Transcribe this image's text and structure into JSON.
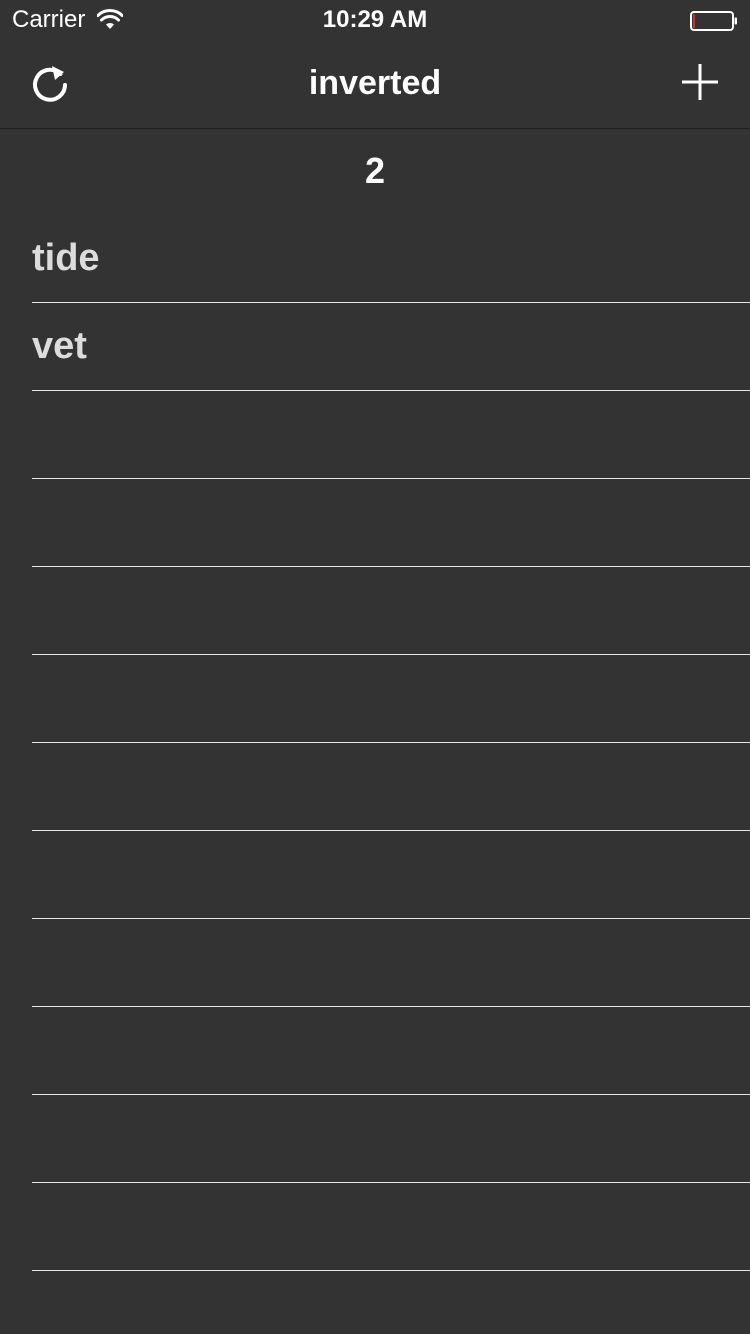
{
  "status_bar": {
    "carrier": "Carrier",
    "time": "10:29 AM"
  },
  "nav": {
    "title": "inverted",
    "left_icon": "refresh-icon",
    "right_icon": "plus-icon"
  },
  "count": "2",
  "rows": [
    {
      "label": "tide"
    },
    {
      "label": "vet"
    },
    {
      "label": ""
    },
    {
      "label": ""
    },
    {
      "label": ""
    },
    {
      "label": ""
    },
    {
      "label": ""
    },
    {
      "label": ""
    },
    {
      "label": ""
    },
    {
      "label": ""
    },
    {
      "label": ""
    },
    {
      "label": ""
    },
    {
      "label": ""
    }
  ],
  "colors": {
    "background": "#333333",
    "text": "#ffffff",
    "row_text": "#dcdcdc",
    "separator": "#e6e6e6",
    "battery_low": "#d0302a"
  }
}
